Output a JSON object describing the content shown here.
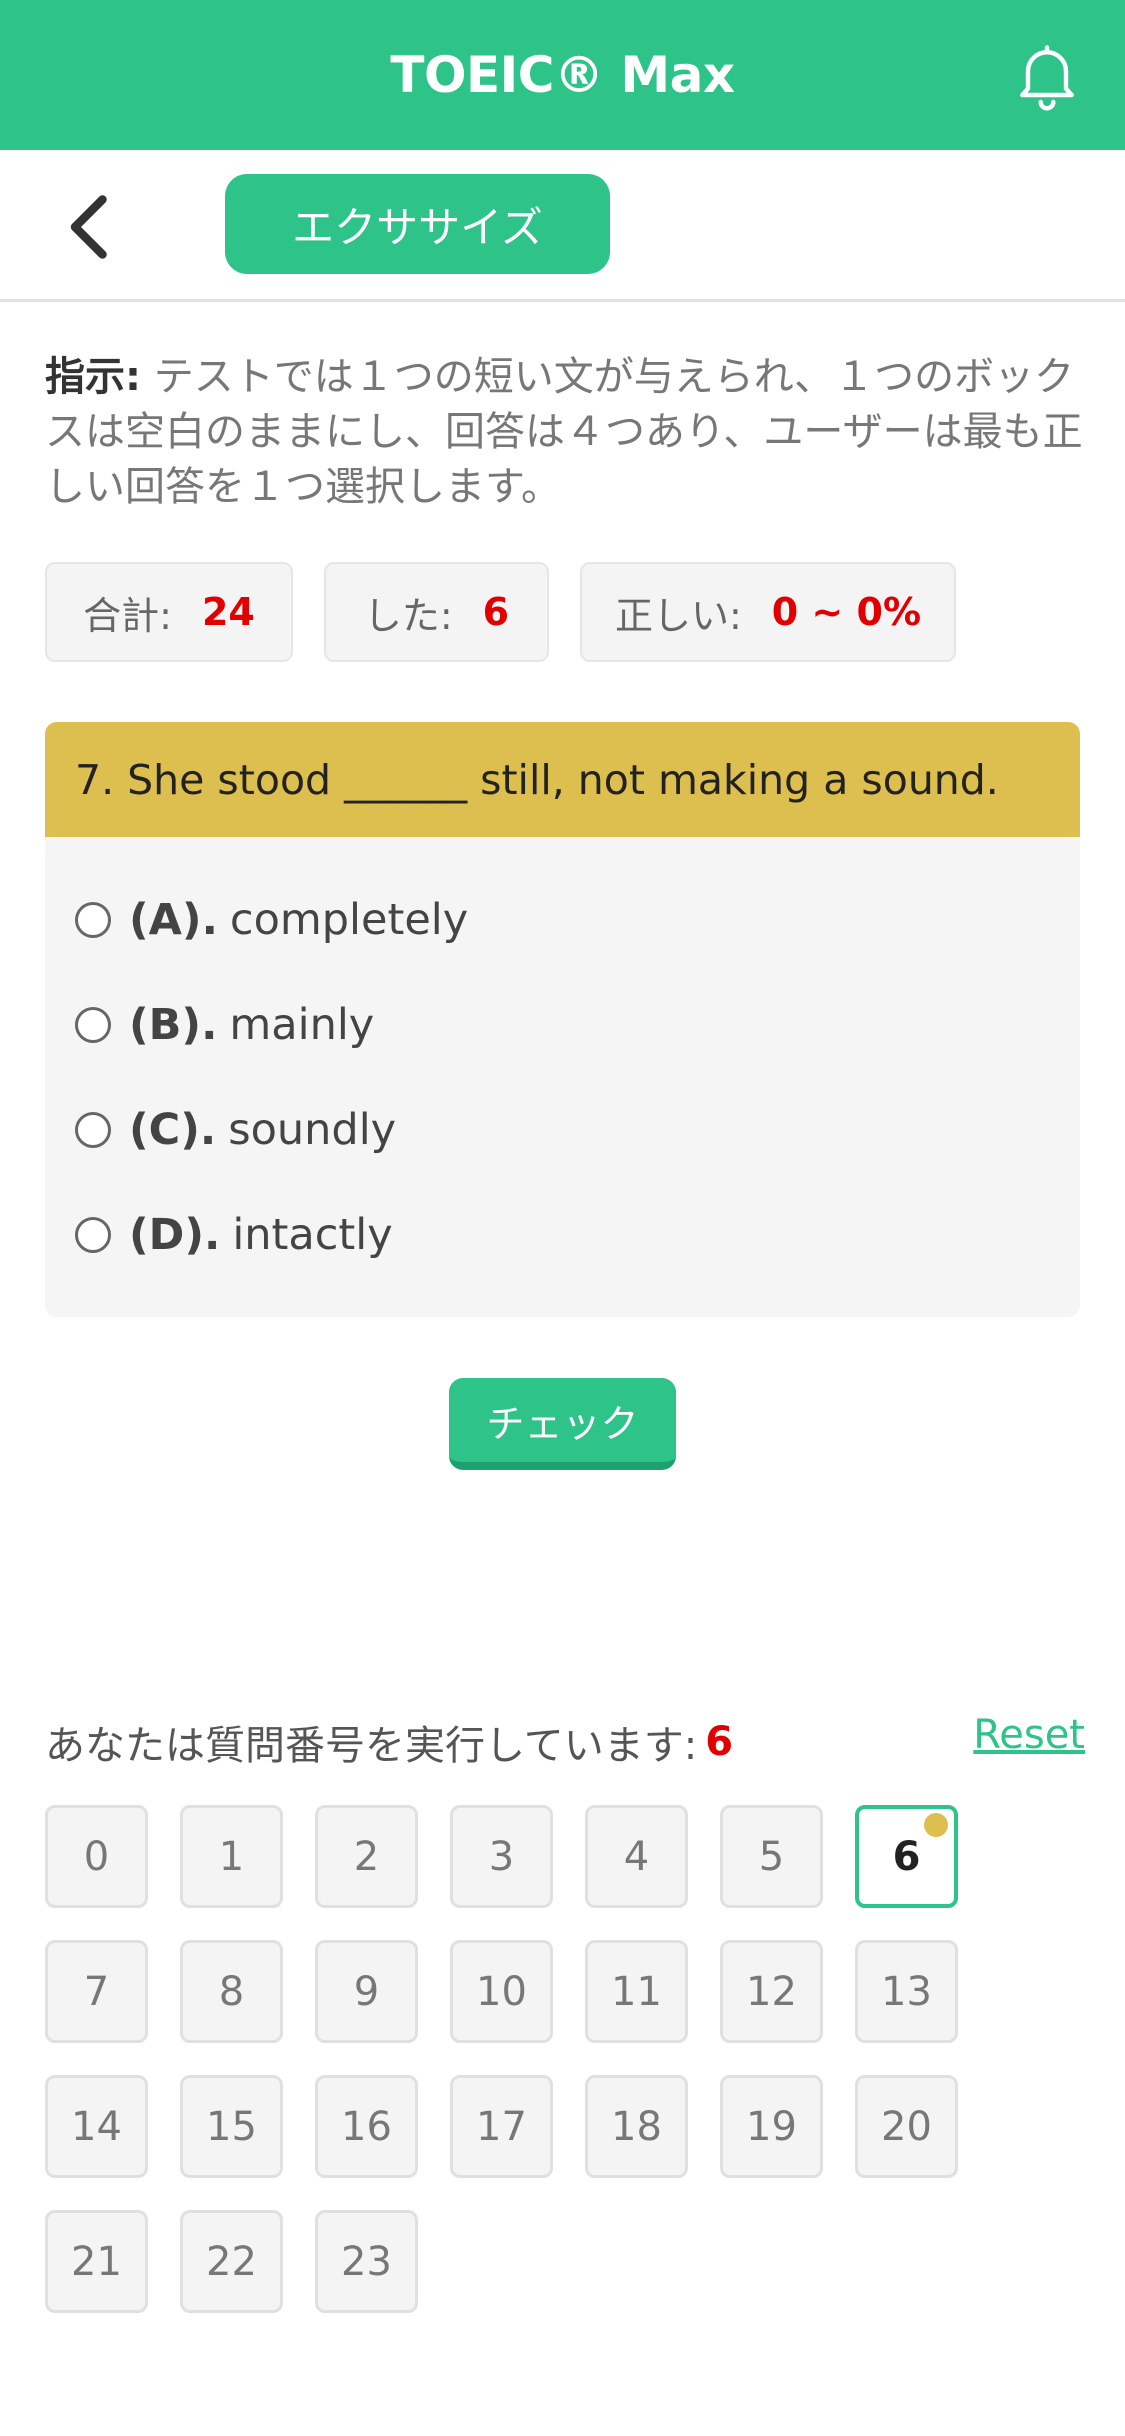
{
  "header": {
    "title": "TOEIC® Max",
    "bell_icon": "bell-icon"
  },
  "subbar": {
    "back_icon": "chevron-left-icon",
    "tab_label": "エクササイズ"
  },
  "instructions": {
    "label": "指示:",
    "text": "テストでは１つの短い文が与えられ、１つのボックスは空白のままにし、回答は４つあり、ユーザーは最も正しい回答を１つ選択します。"
  },
  "stats": {
    "total_label": "合計:",
    "total_value": "24",
    "done_label": "した:",
    "done_value": "6",
    "correct_label": "正しい:",
    "correct_value": "0 ~ 0%"
  },
  "question": {
    "text": "7. She stood ______ still, not making a sound.",
    "options": [
      {
        "label": "(A).",
        "text": "completely"
      },
      {
        "label": "(B).",
        "text": "mainly"
      },
      {
        "label": "(C).",
        "text": "soundly"
      },
      {
        "label": "(D).",
        "text": "intactly"
      }
    ]
  },
  "check_button": "チェック",
  "progress": {
    "text": "あなたは質問番号を実行しています:",
    "current": "6",
    "reset_label": "Reset"
  },
  "question_numbers": [
    "0",
    "1",
    "2",
    "3",
    "4",
    "5",
    "6",
    "7",
    "8",
    "9",
    "10",
    "11",
    "12",
    "13",
    "14",
    "15",
    "16",
    "17",
    "18",
    "19",
    "20",
    "21",
    "22",
    "23"
  ],
  "active_index": 6,
  "colors": {
    "primary": "#2dc389",
    "question_header": "#dcbf4e",
    "highlight_number": "#e00000"
  }
}
